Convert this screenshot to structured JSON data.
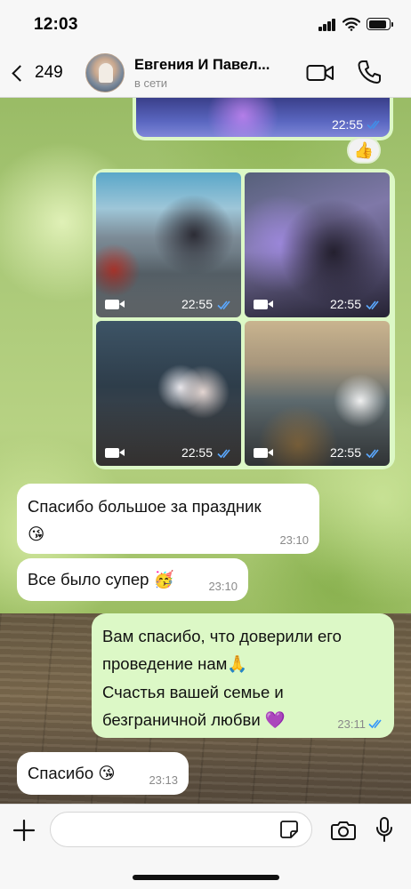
{
  "status_bar": {
    "time": "12:03"
  },
  "header": {
    "back_count": "249",
    "contact_name": "Евгения И Павел...",
    "contact_status": "в сети"
  },
  "messages": {
    "top_media": {
      "time": "22:55",
      "reaction": "👍"
    },
    "media_grid": [
      {
        "time": "22:55"
      },
      {
        "time": "22:55"
      },
      {
        "time": "22:55"
      },
      {
        "time": "22:55"
      }
    ],
    "m1": {
      "text": "Спасибо большое за праздник",
      "emoji": "😘",
      "time": "23:10"
    },
    "m2": {
      "text": "Все было супер",
      "emoji": "🥳",
      "time": "23:10"
    },
    "m3": {
      "line1": "Вам спасибо, что доверили его",
      "line2": "проведение нам",
      "emoji1": "🙏",
      "line3": "Счастья вашей семье и",
      "line4": "безграничной любви",
      "emoji2": "💜",
      "time": "23:11"
    },
    "m4": {
      "text": "Спасибо",
      "emoji": "😘",
      "time": "23:13"
    }
  },
  "input_bar": {
    "placeholder": ""
  },
  "colors": {
    "outgoing_bubble": "#dcf8c6",
    "incoming_bubble": "#ffffff",
    "read_ticks": "#3497f9"
  }
}
